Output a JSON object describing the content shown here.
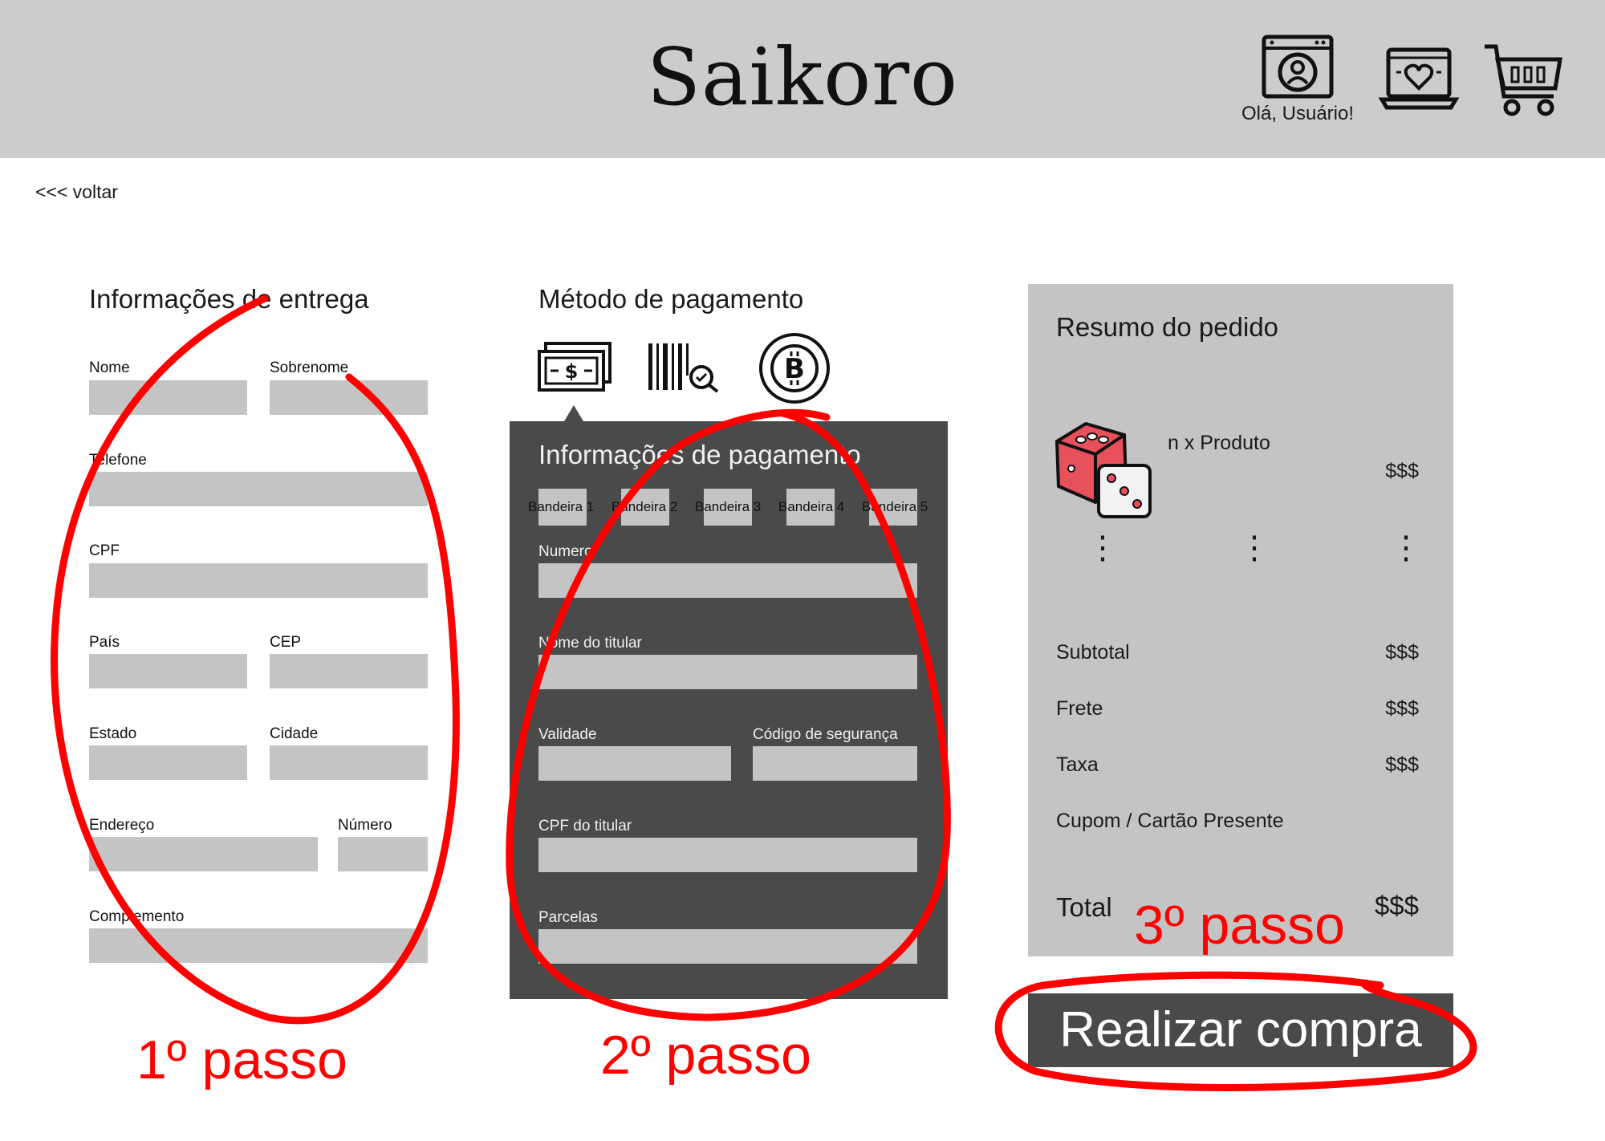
{
  "header": {
    "logo": "Saikoro",
    "greeting": "Olá, Usuário!",
    "icons": [
      "user-account-icon",
      "favorites-laptop-heart-icon",
      "shopping-cart-icon"
    ]
  },
  "back_link": "<<< voltar",
  "delivery": {
    "heading": "Informações de entrega",
    "labels": {
      "nome": "Nome",
      "sobrenome": "Sobrenome",
      "telefone": "Telefone",
      "cpf": "CPF",
      "pais": "País",
      "cep": "CEP",
      "estado": "Estado",
      "cidade": "Cidade",
      "endereco": "Endereço",
      "numero": "Número",
      "complemento": "Complemento"
    }
  },
  "payment": {
    "heading": "Método de pagamento",
    "methods": [
      "cash-money-icon",
      "barcode-boleto-icon",
      "bitcoin-icon"
    ],
    "panel_heading": "Informações de pagamento",
    "flags": [
      "Bandeira 1",
      "Bandeira 2",
      "Bandeira 3",
      "Bandeira 4",
      "Bandeira 5"
    ],
    "labels": {
      "numero": "Numero",
      "nome_titular": "Nome do titular",
      "validade": "Validade",
      "codigo": "Código de segurança",
      "cpf_titular": "CPF do titular",
      "parcelas": "Parcelas"
    }
  },
  "summary": {
    "heading": "Resumo do pedido",
    "product": "n x Produto",
    "product_price": "$$$",
    "rows": [
      {
        "label": "Subtotal",
        "value": "$$$"
      },
      {
        "label": "Frete",
        "value": "$$$"
      },
      {
        "label": "Taxa",
        "value": "$$$"
      },
      {
        "label": "Cupom / Cartão Presente",
        "value": ""
      }
    ],
    "total_label": "Total",
    "total_value": "$$$"
  },
  "buy_button": "Realizar compra",
  "annotations": {
    "step1": "1º passo",
    "step2": "2º passo",
    "step3": "3º passo",
    "color": "#ff0000"
  },
  "colors": {
    "header_bg": "#cccccc",
    "field_bg": "#c4c4c4",
    "panel_bg": "#4a4a4a",
    "dice_red": "#e8505b"
  }
}
